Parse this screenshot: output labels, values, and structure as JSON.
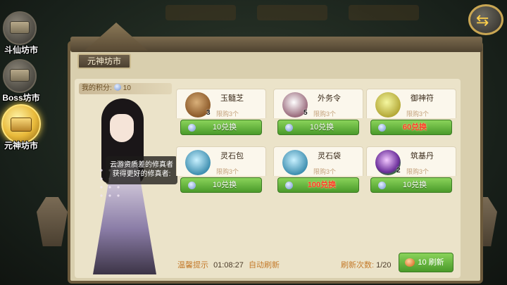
{
  "sidebar": {
    "tabs": [
      {
        "label": "斗仙坊市"
      },
      {
        "label": "Boss坊市"
      },
      {
        "label": "元神坊市"
      }
    ]
  },
  "header": {
    "title": "元神坊市"
  },
  "score": {
    "label": "我的积分:",
    "value": "10"
  },
  "tooltip": {
    "line1": "云游资质差的修真者",
    "line2": "获得更好的修真者:"
  },
  "items": [
    {
      "name": "玉髓芝",
      "qty": "3",
      "limit": "限购3个",
      "button": "10兑换",
      "icon": "mushroom-icon"
    },
    {
      "name": "外务令",
      "qty": "5",
      "limit": "限购3个",
      "button": "10兑换",
      "icon": "token-icon"
    },
    {
      "name": "御神符",
      "qty": "",
      "limit": "限购3个",
      "button": "60兑换",
      "icon": "talisman-icon"
    },
    {
      "name": "灵石包",
      "qty": "",
      "limit": "限购3个",
      "button": "10兑换",
      "icon": "spirit-stone-bag-icon"
    },
    {
      "name": "灵石袋",
      "qty": "",
      "limit": "限购3个",
      "button": "100兑换",
      "icon": "spirit-stone-pouch-icon"
    },
    {
      "name": "筑基丹",
      "qty": "2",
      "limit": "限购3个",
      "button": "10兑换",
      "icon": "pill-icon"
    }
  ],
  "footer": {
    "tip_label": "温馨提示",
    "time": "01:08:27",
    "auto_refresh": "自动刷新",
    "refresh_count_label": "刷新次数:",
    "refresh_count": "1/20",
    "refresh_button": "10 刷新"
  },
  "colors": {
    "accent_green": "#4a9a2a",
    "warning_red": "#ff3b2c",
    "tip_orange": "#c47a2a"
  }
}
